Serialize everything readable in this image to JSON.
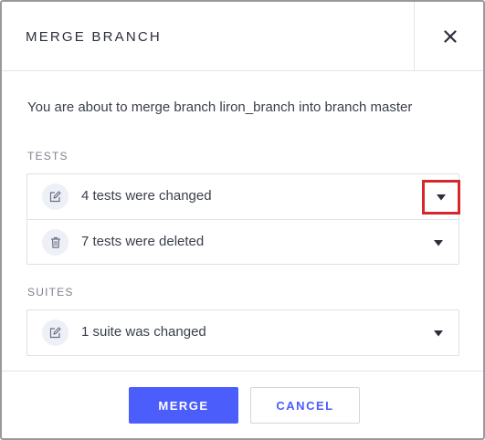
{
  "dialog": {
    "title": "MERGE BRANCH",
    "close_icon": "close-icon",
    "message": "You are about to merge branch liron_branch into branch master"
  },
  "tests": {
    "label": "TESTS",
    "items": [
      {
        "icon": "edit-icon",
        "text": "4 tests were changed"
      },
      {
        "icon": "trash-icon",
        "text": "7 tests were deleted"
      }
    ]
  },
  "suites": {
    "label": "SUITES",
    "items": [
      {
        "icon": "edit-icon",
        "text": "1 suite was changed"
      }
    ]
  },
  "buttons": {
    "merge": "MERGE",
    "cancel": "CANCEL"
  },
  "colors": {
    "accent": "#4b5efc",
    "highlight": "#d9262c",
    "icon_bg": "#eef0f8"
  }
}
